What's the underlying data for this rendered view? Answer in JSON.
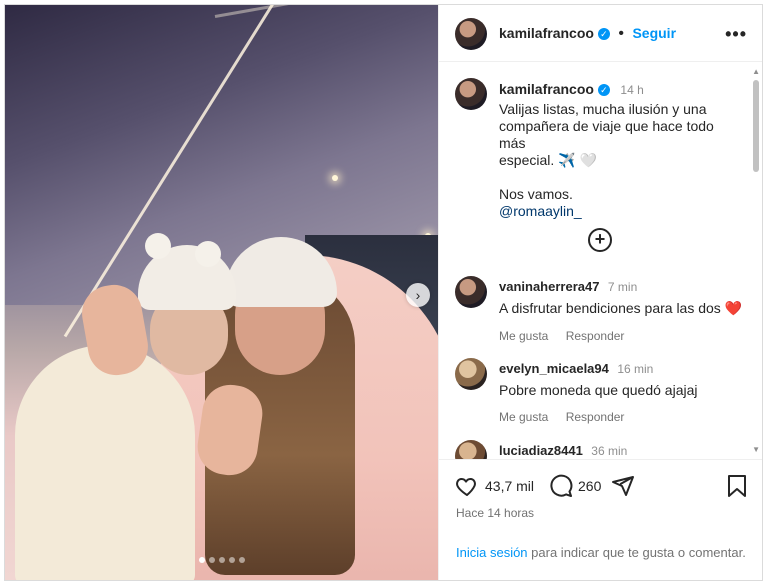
{
  "post": {
    "author": "kamilafrancoo",
    "follow_label": "Seguir",
    "more_icon": "more-horizontal-icon",
    "caption_time": "14 h",
    "caption_line1": "Valijas listas, mucha ilusión y una",
    "caption_line2": "compañera de viaje que hace todo más",
    "caption_line3": "especial. ✈️ 🤍",
    "caption_line4": "Nos vamos.",
    "mention": "@romaaylin_",
    "add_icon": "plus-circle-icon"
  },
  "comments": [
    {
      "user": "vaninaherrera47",
      "time": "7 min",
      "text": "A disfrutar bendiciones para las dos",
      "emoji": "❤️",
      "like": "Me gusta",
      "reply": "Responder"
    },
    {
      "user": "evelyn_micaela94",
      "time": "16 min",
      "text": "Pobre moneda que quedó ajajaj",
      "like": "Me gusta",
      "reply": "Responder"
    },
    {
      "user": "luciadiaz8441",
      "time": "36 min"
    }
  ],
  "stats": {
    "likes": "43,7 mil",
    "comments": "260",
    "ago": "Hace 14 horas"
  },
  "login": {
    "link": "Inicia sesión",
    "text": "para indicar que te gusta o comentar."
  },
  "carousel": {
    "current_slide": 1,
    "total_slides": 5
  },
  "colors": {
    "accent": "#0095f6",
    "text": "#262626",
    "muted": "#737373",
    "heart": "#ed4956"
  }
}
